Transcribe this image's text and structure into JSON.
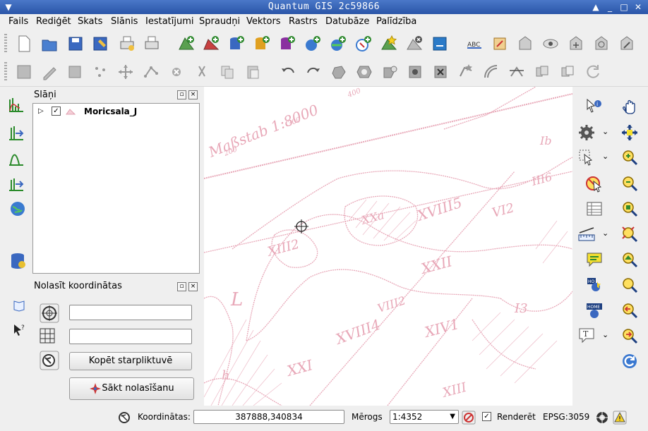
{
  "window": {
    "title": "Quantum GIS 2c59866"
  },
  "menu": [
    "Fails",
    "Rediģēt",
    "Skats",
    "Slānis",
    "Iestatījumi",
    "Spraudņi",
    "Vektors",
    "Rastrs",
    "Datubāze",
    "Palīdzība"
  ],
  "layers_panel": {
    "title": "Slāņi",
    "layer_name": "Moricsala_J"
  },
  "coord_panel": {
    "title": "Nolasīt koordinātas",
    "field1": "",
    "field2": "",
    "copy_button": "Kopēt starpliktuvē",
    "start_button": "Sākt nolasīšanu"
  },
  "map_labels": {
    "scale": "Maßstab 1:8000",
    "s200": "200",
    "s300": "300",
    "s400": "400",
    "l1": "XXa",
    "l2": "XVIII5",
    "l3": "XIII2",
    "l4": "XVIII4",
    "l5": "XIV1",
    "l6": "XXI",
    "l7": "XXII",
    "l8": "VI2",
    "l9": "III6",
    "l10": "VIII2",
    "l11": "I3",
    "l12": "L",
    "l13": "h",
    "l14": "XIII",
    "l15": "Ib"
  },
  "status": {
    "coord_label": "Koordinātas:",
    "coord_value": "387888,340834",
    "scale_label": "Mērogs",
    "scale_value": "1:4352",
    "render_label": "Renderēt",
    "render_checked": true,
    "epsg": "EPSG:3059"
  },
  "colors": {
    "map_ink": "#e8a8b8",
    "title_bg": "#3460b8"
  }
}
